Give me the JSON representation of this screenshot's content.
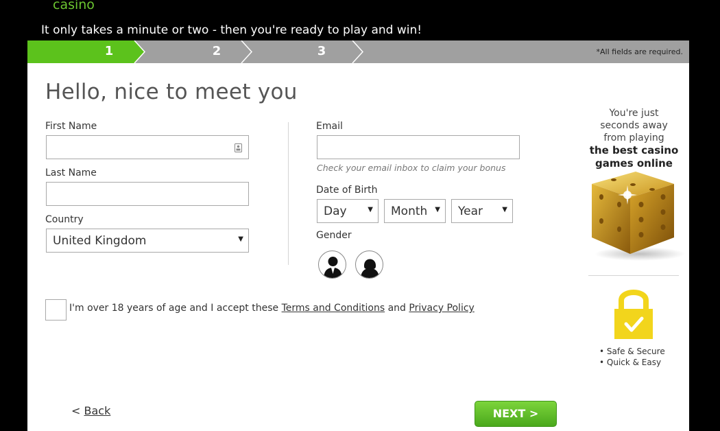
{
  "header": {
    "brand": "casino",
    "tagline": "It only takes a minute or two - then you're ready to play and win!"
  },
  "steps": {
    "items": [
      "1",
      "2",
      "3"
    ],
    "active": 1,
    "required_note": "*All fields are required."
  },
  "form": {
    "title": "Hello, nice to meet you",
    "first_name": {
      "label": "First Name",
      "value": ""
    },
    "last_name": {
      "label": "Last Name",
      "value": ""
    },
    "country": {
      "label": "Country",
      "value": "United Kingdom"
    },
    "email": {
      "label": "Email",
      "value": "",
      "hint": "Check your email inbox to claim your bonus"
    },
    "dob": {
      "label": "Date of Birth",
      "day": "Day",
      "month": "Month",
      "year": "Year"
    },
    "gender": {
      "label": "Gender"
    },
    "terms": {
      "prefix": "I'm over 18 years of age and I accept these ",
      "terms_link": "Terms and Conditions",
      "and": " and ",
      "privacy_link": "Privacy Policy",
      "checked": false
    }
  },
  "nav": {
    "back_arrow": "<",
    "back": "Back",
    "next": "NEXT >"
  },
  "promo": {
    "line1": "You're just seconds away from playing",
    "line2": "the best casino games online",
    "bullet1": "• Safe & Secure",
    "bullet2": "• Quick & Easy"
  },
  "colors": {
    "accent_green": "#6cc631",
    "step_active": "#5cc21c",
    "step_inactive": "#a0a0a0",
    "lock_yellow": "#f2d51c"
  },
  "icons": {
    "input_contact": "contact-card-icon",
    "select_caret": "caret-down-icon",
    "gender_male": "male-avatar-icon",
    "gender_female": "female-avatar-icon",
    "dice": "golden-dice-icon",
    "lock": "padlock-icon"
  }
}
